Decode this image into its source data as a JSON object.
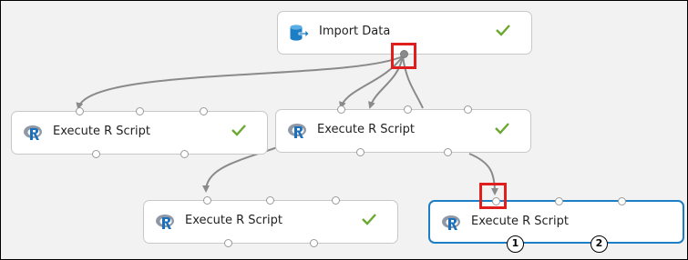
{
  "canvas": {
    "modules": {
      "import_data": {
        "label": "Import Data",
        "status": "completed",
        "icon": "import-data-icon"
      },
      "execute_r_1": {
        "label": "Execute R Script",
        "status": "completed",
        "icon": "r-logo-icon"
      },
      "execute_r_2": {
        "label": "Execute R Script",
        "status": "completed",
        "icon": "r-logo-icon"
      },
      "execute_r_3": {
        "label": "Execute R Script",
        "status": "completed",
        "icon": "r-logo-icon"
      },
      "execute_r_4": {
        "label": "Execute R Script",
        "status": "not-run",
        "icon": "r-logo-icon",
        "selected": true
      }
    },
    "port_badges": [
      "1",
      "2"
    ]
  },
  "colors": {
    "accent": "#1c7ec5",
    "check_green": "#6aa82f",
    "highlight_red": "#e01e1e",
    "connector": "#8a8a8a"
  }
}
